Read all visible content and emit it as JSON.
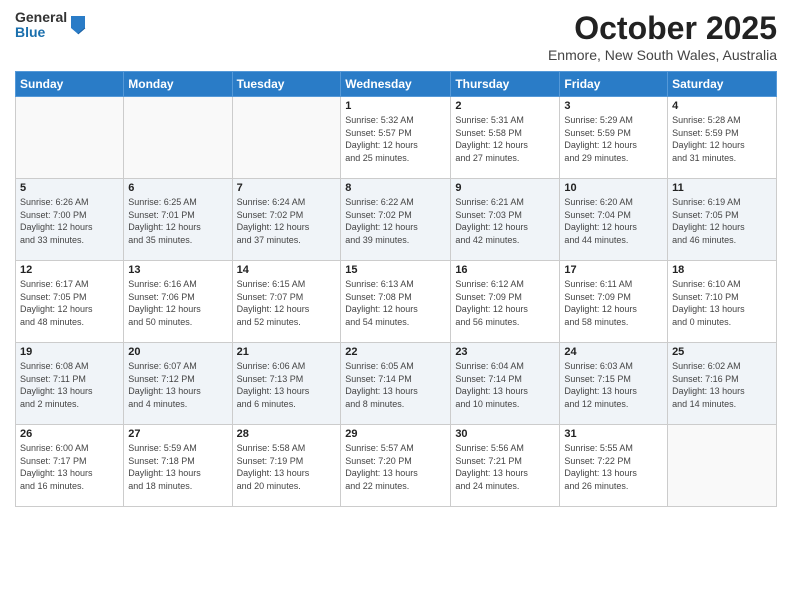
{
  "logo": {
    "general": "General",
    "blue": "Blue"
  },
  "header": {
    "month": "October 2025",
    "location": "Enmore, New South Wales, Australia"
  },
  "weekdays": [
    "Sunday",
    "Monday",
    "Tuesday",
    "Wednesday",
    "Thursday",
    "Friday",
    "Saturday"
  ],
  "weeks": [
    [
      {
        "day": "",
        "info": ""
      },
      {
        "day": "",
        "info": ""
      },
      {
        "day": "",
        "info": ""
      },
      {
        "day": "1",
        "info": "Sunrise: 5:32 AM\nSunset: 5:57 PM\nDaylight: 12 hours\nand 25 minutes."
      },
      {
        "day": "2",
        "info": "Sunrise: 5:31 AM\nSunset: 5:58 PM\nDaylight: 12 hours\nand 27 minutes."
      },
      {
        "day": "3",
        "info": "Sunrise: 5:29 AM\nSunset: 5:59 PM\nDaylight: 12 hours\nand 29 minutes."
      },
      {
        "day": "4",
        "info": "Sunrise: 5:28 AM\nSunset: 5:59 PM\nDaylight: 12 hours\nand 31 minutes."
      }
    ],
    [
      {
        "day": "5",
        "info": "Sunrise: 6:26 AM\nSunset: 7:00 PM\nDaylight: 12 hours\nand 33 minutes."
      },
      {
        "day": "6",
        "info": "Sunrise: 6:25 AM\nSunset: 7:01 PM\nDaylight: 12 hours\nand 35 minutes."
      },
      {
        "day": "7",
        "info": "Sunrise: 6:24 AM\nSunset: 7:02 PM\nDaylight: 12 hours\nand 37 minutes."
      },
      {
        "day": "8",
        "info": "Sunrise: 6:22 AM\nSunset: 7:02 PM\nDaylight: 12 hours\nand 39 minutes."
      },
      {
        "day": "9",
        "info": "Sunrise: 6:21 AM\nSunset: 7:03 PM\nDaylight: 12 hours\nand 42 minutes."
      },
      {
        "day": "10",
        "info": "Sunrise: 6:20 AM\nSunset: 7:04 PM\nDaylight: 12 hours\nand 44 minutes."
      },
      {
        "day": "11",
        "info": "Sunrise: 6:19 AM\nSunset: 7:05 PM\nDaylight: 12 hours\nand 46 minutes."
      }
    ],
    [
      {
        "day": "12",
        "info": "Sunrise: 6:17 AM\nSunset: 7:05 PM\nDaylight: 12 hours\nand 48 minutes."
      },
      {
        "day": "13",
        "info": "Sunrise: 6:16 AM\nSunset: 7:06 PM\nDaylight: 12 hours\nand 50 minutes."
      },
      {
        "day": "14",
        "info": "Sunrise: 6:15 AM\nSunset: 7:07 PM\nDaylight: 12 hours\nand 52 minutes."
      },
      {
        "day": "15",
        "info": "Sunrise: 6:13 AM\nSunset: 7:08 PM\nDaylight: 12 hours\nand 54 minutes."
      },
      {
        "day": "16",
        "info": "Sunrise: 6:12 AM\nSunset: 7:09 PM\nDaylight: 12 hours\nand 56 minutes."
      },
      {
        "day": "17",
        "info": "Sunrise: 6:11 AM\nSunset: 7:09 PM\nDaylight: 12 hours\nand 58 minutes."
      },
      {
        "day": "18",
        "info": "Sunrise: 6:10 AM\nSunset: 7:10 PM\nDaylight: 13 hours\nand 0 minutes."
      }
    ],
    [
      {
        "day": "19",
        "info": "Sunrise: 6:08 AM\nSunset: 7:11 PM\nDaylight: 13 hours\nand 2 minutes."
      },
      {
        "day": "20",
        "info": "Sunrise: 6:07 AM\nSunset: 7:12 PM\nDaylight: 13 hours\nand 4 minutes."
      },
      {
        "day": "21",
        "info": "Sunrise: 6:06 AM\nSunset: 7:13 PM\nDaylight: 13 hours\nand 6 minutes."
      },
      {
        "day": "22",
        "info": "Sunrise: 6:05 AM\nSunset: 7:14 PM\nDaylight: 13 hours\nand 8 minutes."
      },
      {
        "day": "23",
        "info": "Sunrise: 6:04 AM\nSunset: 7:14 PM\nDaylight: 13 hours\nand 10 minutes."
      },
      {
        "day": "24",
        "info": "Sunrise: 6:03 AM\nSunset: 7:15 PM\nDaylight: 13 hours\nand 12 minutes."
      },
      {
        "day": "25",
        "info": "Sunrise: 6:02 AM\nSunset: 7:16 PM\nDaylight: 13 hours\nand 14 minutes."
      }
    ],
    [
      {
        "day": "26",
        "info": "Sunrise: 6:00 AM\nSunset: 7:17 PM\nDaylight: 13 hours\nand 16 minutes."
      },
      {
        "day": "27",
        "info": "Sunrise: 5:59 AM\nSunset: 7:18 PM\nDaylight: 13 hours\nand 18 minutes."
      },
      {
        "day": "28",
        "info": "Sunrise: 5:58 AM\nSunset: 7:19 PM\nDaylight: 13 hours\nand 20 minutes."
      },
      {
        "day": "29",
        "info": "Sunrise: 5:57 AM\nSunset: 7:20 PM\nDaylight: 13 hours\nand 22 minutes."
      },
      {
        "day": "30",
        "info": "Sunrise: 5:56 AM\nSunset: 7:21 PM\nDaylight: 13 hours\nand 24 minutes."
      },
      {
        "day": "31",
        "info": "Sunrise: 5:55 AM\nSunset: 7:22 PM\nDaylight: 13 hours\nand 26 minutes."
      },
      {
        "day": "",
        "info": ""
      }
    ]
  ]
}
